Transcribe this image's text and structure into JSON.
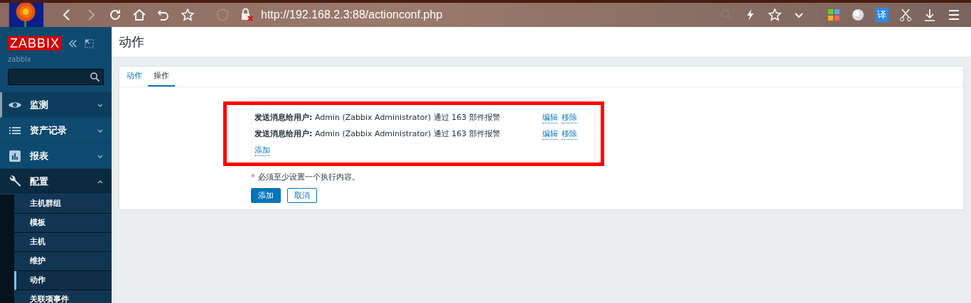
{
  "browser": {
    "url": "http://192.168.2.3:88/actionconf.php",
    "translate_label": "译"
  },
  "sidebar": {
    "logo": "ZABBIX",
    "server": "zabbix",
    "menu": [
      {
        "label": "监测",
        "kind": "eye",
        "expanded": false
      },
      {
        "label": "资产记录",
        "kind": "list",
        "expanded": false
      },
      {
        "label": "报表",
        "kind": "chart",
        "expanded": false
      },
      {
        "label": "配置",
        "kind": "wrench",
        "expanded": true,
        "children": [
          {
            "label": "主机群组",
            "selected": false
          },
          {
            "label": "模板",
            "selected": false
          },
          {
            "label": "主机",
            "selected": false
          },
          {
            "label": "维护",
            "selected": false
          },
          {
            "label": "动作",
            "selected": true
          },
          {
            "label": "关联项事件",
            "selected": false
          }
        ]
      }
    ]
  },
  "page": {
    "title": "动作"
  },
  "tabs": [
    {
      "label": "动作",
      "selected": false
    },
    {
      "label": "操作",
      "selected": true
    }
  ],
  "operations": {
    "rows": [
      {
        "details": "**发送消息给用户:** Admin (Zabbix Administrator) 通过 163 部件报警",
        "actions": [
          "编辑",
          "移除"
        ]
      },
      {
        "details": "**发送消息给用户:** Admin (Zabbix Administrator) 通过 163 部件报警",
        "actions": [
          "编辑",
          "移除"
        ]
      }
    ],
    "add_link": "添加"
  },
  "note": {
    "mark": "*",
    "text": "必须至少设置一个执行内容。"
  },
  "buttons": [
    {
      "label": "添加",
      "kind": "primary"
    },
    {
      "label": "取消",
      "kind": "secondary"
    }
  ]
}
